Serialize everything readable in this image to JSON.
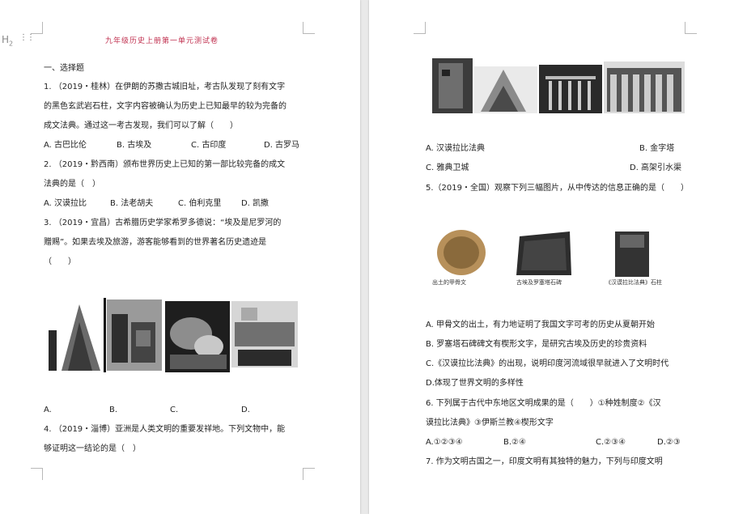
{
  "page_title": "九年级历史上册第一单元测试卷",
  "heading_marker": "H2",
  "section1": "一、选择题",
  "q1": {
    "lines": [
      "1. （2019・桂林）在伊朗的苏撒古城旧址，考古队发现了刻有文字",
      "的黑色玄武岩石柱，文字内容被确认为历史上已知最早的较为完备的",
      "成文法典。通过这一考古发现，我们可以了解（　　）"
    ],
    "options": [
      "A. 古巴比伦",
      "B. 古埃及",
      "C. 古印度",
      "D. 古罗马"
    ]
  },
  "q2": {
    "lines": [
      "2. （2019・黔西南）颁布世界历史上已知的第一部比较完备的成文",
      "法典的是（　）"
    ],
    "options": [
      "A. 汉谟拉比",
      "B. 法老胡夫",
      "C. 伯利克里",
      "D. 凯撒"
    ]
  },
  "q3": {
    "lines": [
      "3. （2019・宜昌）古希腊历史学家希罗多德说：“埃及是尼罗河的",
      "赠赐”。如果去埃及旅游，游客能够看到的世界著名历史遗迹是",
      "（　　）"
    ],
    "options": [
      "A.",
      "B.",
      "C.",
      "D."
    ]
  },
  "q4": {
    "lines": [
      "4. （2019・淄博）亚洲是人类文明的重要发祥地。下列文物中，能",
      "够证明这一结论的是（　）"
    ],
    "options": [
      "A. 汉谟拉比法典",
      "B. 金字塔",
      "C. 雅典卫城",
      "D. 高架引水渠"
    ]
  },
  "q5": {
    "lines": [
      "5.（2019・全国）观察下列三幅图片，从中传达的信息正确的是（　　）"
    ],
    "captions": [
      "出土的甲骨文",
      "古埃及罗塞塔石碑",
      "《汉谟拉比法典》石柱"
    ],
    "options": [
      "A. 甲骨文的出土，有力地证明了我国文字可考的历史从夏朝开始",
      "B. 罗塞塔石碑碑文有楔形文字，是研究古埃及历史的珍贵资料",
      "C.《汉谟拉比法典》的出现，说明印度河流域很早就进入了文明时代",
      "D.体现了世界文明的多样性"
    ]
  },
  "q6": {
    "lines": [
      "6. 下列属于古代中东地区文明成果的是（　　）①种姓制度②《汉",
      "谟拉比法典》③伊斯兰教④楔形文字"
    ],
    "options": [
      "A.①②③④",
      "B.②④",
      "C.②③④",
      "D.②③"
    ]
  },
  "q7": {
    "lines": [
      "7. 作为文明古国之一，印度文明有其独特的魅力，下列与印度文明"
    ]
  }
}
